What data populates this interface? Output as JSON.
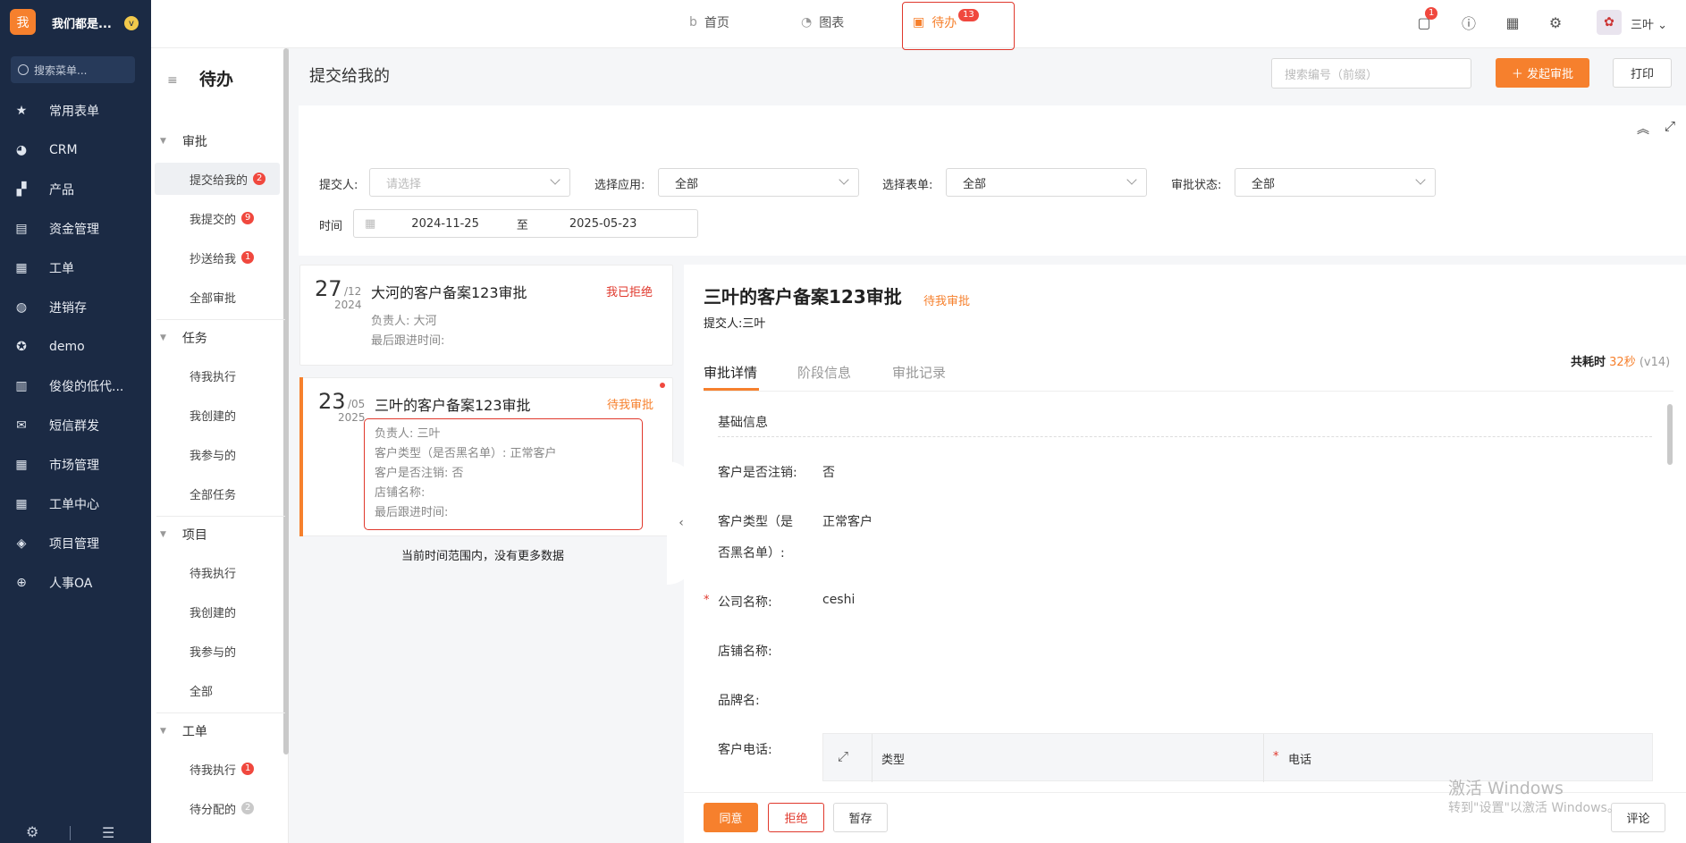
{
  "sidebar": {
    "logo_char": "我",
    "org_name": "我们都是...",
    "org_badge": "v",
    "search_placeholder": "搜索菜单...",
    "items": [
      {
        "label": "常用表单",
        "icon": "star-icon"
      },
      {
        "label": "CRM",
        "icon": "pie-chart-icon"
      },
      {
        "label": "产品",
        "icon": "product-icon"
      },
      {
        "label": "资金管理",
        "icon": "finance-icon"
      },
      {
        "label": "工单",
        "icon": "clipboard-icon"
      },
      {
        "label": "进销存",
        "icon": "inventory-icon"
      },
      {
        "label": "demo",
        "icon": "settings-circle-icon"
      },
      {
        "label": "俊俊的低代...",
        "icon": "document-icon"
      },
      {
        "label": "短信群发",
        "icon": "mail-icon"
      },
      {
        "label": "市场管理",
        "icon": "clipboard-icon"
      },
      {
        "label": "工单中心",
        "icon": "clipboard-icon"
      },
      {
        "label": "项目管理",
        "icon": "layers-icon"
      },
      {
        "label": "人事OA",
        "icon": "globe-icon"
      }
    ]
  },
  "topnav": {
    "tabs": [
      {
        "label": "首页",
        "icon": "b-logo-icon"
      },
      {
        "label": "图表",
        "icon": "chart-icon"
      },
      {
        "label": "待办",
        "icon": "calendar-icon",
        "badge": "13"
      }
    ],
    "message_badge": "1",
    "user_name": "三叶"
  },
  "subnav": {
    "title": "待办",
    "groups": [
      {
        "label": "审批",
        "items": [
          {
            "label": "提交给我的",
            "badge": "2"
          },
          {
            "label": "我提交的",
            "badge": "9"
          },
          {
            "label": "抄送给我",
            "badge": "1"
          },
          {
            "label": "全部审批"
          }
        ]
      },
      {
        "label": "任务",
        "items": [
          {
            "label": "待我执行"
          },
          {
            "label": "我创建的"
          },
          {
            "label": "我参与的"
          },
          {
            "label": "全部任务"
          }
        ]
      },
      {
        "label": "项目",
        "items": [
          {
            "label": "待我执行"
          },
          {
            "label": "我创建的"
          },
          {
            "label": "我参与的"
          },
          {
            "label": "全部"
          }
        ]
      },
      {
        "label": "工单",
        "items": [
          {
            "label": "待我执行",
            "badge": "1"
          },
          {
            "label": "待分配的",
            "badge": "2"
          }
        ]
      }
    ]
  },
  "main": {
    "title": "提交给我的",
    "search_placeholder": "搜索编号（前缀）",
    "start_button": "＋ 发起审批",
    "print_button": "打印"
  },
  "filters": {
    "submitter_label": "提交人:",
    "submitter_placeholder": "请选择",
    "app_label": "选择应用:",
    "app_value": "全部",
    "form_label": "选择表单:",
    "form_value": "全部",
    "status_label": "审批状态:",
    "status_value": "全部",
    "time_label": "时间",
    "date_from": "2024-11-25",
    "date_sep": "至",
    "date_to": "2025-05-23"
  },
  "cards": [
    {
      "day": "27",
      "month": "/12",
      "year": "2024",
      "title": "大河的客户备案123审批",
      "status": "我已拒绝",
      "status_color": "#e0382c",
      "lines": [
        "负责人: 大河",
        "最后跟进时间:"
      ]
    },
    {
      "day": "23",
      "month": "/05",
      "year": "2025",
      "title": "三叶的客户备案123审批",
      "status": "待我审批",
      "status_color": "#f6802d",
      "lines": [
        "负责人: 三叶",
        "客户类型（是否黑名单）: 正常客户",
        "客户是否注销: 否",
        "店铺名称:",
        "最后跟进时间:"
      ]
    }
  ],
  "list_end_text": "当前时间范围内，没有更多数据",
  "detail": {
    "title": "三叶的客户备案123审批",
    "status": "待我审批",
    "submitter": "提交人:三叶",
    "elapsed_label": "共耗时",
    "elapsed_value": "32秒",
    "version": "(v14)",
    "tabs": [
      "审批详情",
      "阶段信息",
      "审批记录"
    ],
    "section": "基础信息",
    "fields": [
      {
        "label": "客户是否注销:",
        "value": "否"
      },
      {
        "label1": "客户类型（是",
        "label2": "否黑名单）:",
        "value": "正常客户"
      },
      {
        "label": "公司名称:",
        "value": "ceshi",
        "required": true
      },
      {
        "label": "店铺名称:",
        "value": ""
      },
      {
        "label": "品牌名:",
        "value": ""
      },
      {
        "label": "客户电话:",
        "value": ""
      }
    ],
    "phone_table": {
      "col1": "类型",
      "col2": "电话"
    },
    "buttons": {
      "agree": "同意",
      "reject": "拒绝",
      "save": "暂存",
      "comment": "评论"
    }
  },
  "watermark": {
    "line1": "激活 Windows",
    "line2": "转到\"设置\"以激活 Windows。"
  }
}
